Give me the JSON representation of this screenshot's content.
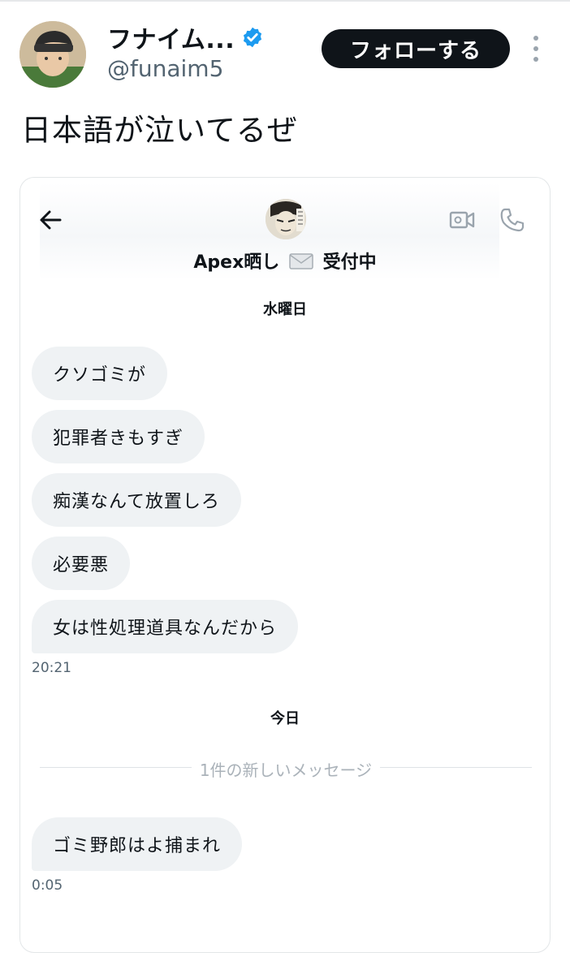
{
  "tweet": {
    "display_name": "フナイム...",
    "handle": "@funaim5",
    "follow_label": "フォローする",
    "text": "日本語が泣いてるぜ"
  },
  "dm": {
    "title_left": "Apex晒し",
    "title_right": "受付中",
    "days": [
      {
        "label": "水曜日",
        "messages": [
          "クソゴミが",
          "犯罪者きもすぎ",
          "痴漢なんて放置しろ",
          "必要悪",
          "女は性処理道具なんだから"
        ],
        "time": "20:21"
      },
      {
        "label": "今日",
        "new_messages_divider": "1件の新しいメッセージ",
        "messages": [
          "ゴミ野郎はよ捕まれ"
        ],
        "time": "0:05"
      }
    ]
  },
  "colors": {
    "verified": "#1d9bf0",
    "bubble": "#eff2f4",
    "follow_button": "#0f1419"
  }
}
